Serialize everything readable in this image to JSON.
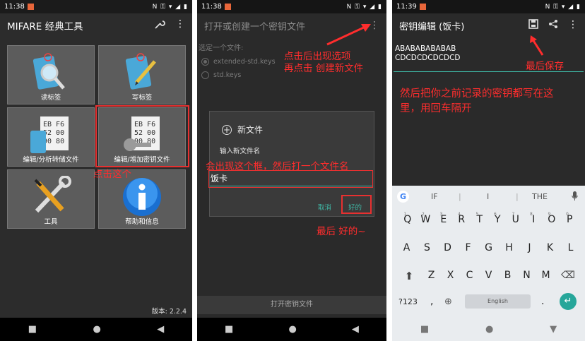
{
  "phone1": {
    "status": {
      "time": "11:38",
      "icons": "N ⚿ ▾ ◢ ▮"
    },
    "title": "MIFARE 经典工具",
    "tiles": [
      {
        "label": "读标签",
        "icon": "read-tag-icon"
      },
      {
        "label": "写标签",
        "icon": "write-tag-icon"
      },
      {
        "label": "编辑/分析转储文件",
        "icon": "dump-file-icon"
      },
      {
        "label": "编辑/增加密钥文件",
        "icon": "key-file-icon"
      },
      {
        "label": "工具",
        "icon": "tools-icon"
      },
      {
        "label": "帮助和信息",
        "icon": "info-icon"
      }
    ],
    "version": "版本: 2.2.4",
    "annotation": "点击这个"
  },
  "phone2": {
    "status": {
      "time": "11:38",
      "icons": "N ⚿ ▾ ◢ ▮"
    },
    "title": "打开或创建一个密钥文件",
    "select_label": "选定一个文件:",
    "files": [
      "extended-std.keys",
      "std.keys"
    ],
    "dialog": {
      "title": "新文件",
      "prompt": "输入新文件名",
      "value": "饭卡",
      "cancel": "取消",
      "ok": "好的"
    },
    "open_button": "打开密钥文件",
    "annotations": {
      "menu": "点击后出现选项\n再点击 创建新文件",
      "dialog": "会出现这个框，然后打一个文件名",
      "ok": "最后 好的~"
    }
  },
  "phone3": {
    "status": {
      "time": "11:39",
      "icons": "N ⚿ ▾ ◢ ▮"
    },
    "title": "密钥编辑 (饭卡)",
    "keys": [
      "ABABABABABAB",
      "CDCDCDCDCDCD"
    ],
    "annotations": {
      "save": "最后保存",
      "info": "然后把你之前记录的密钥都写在这\n里，用回车隔开"
    },
    "keyboard": {
      "suggestions": [
        "IF",
        "I",
        "THE"
      ],
      "row1": [
        "Q",
        "W",
        "E",
        "R",
        "T",
        "Y",
        "U",
        "I",
        "O",
        "P"
      ],
      "row1_hints": [
        "1",
        "2",
        "3",
        "4",
        "5",
        "6",
        "7",
        "8",
        "9",
        "0"
      ],
      "row2": [
        "A",
        "S",
        "D",
        "F",
        "G",
        "H",
        "J",
        "K",
        "L"
      ],
      "row3": [
        "Z",
        "X",
        "C",
        "V",
        "B",
        "N",
        "M"
      ],
      "symbols": "?123",
      "comma": ",",
      "period": ".",
      "space": "English"
    }
  },
  "colors": {
    "annotation": "#ff2d2d",
    "accent": "#26a69a"
  }
}
